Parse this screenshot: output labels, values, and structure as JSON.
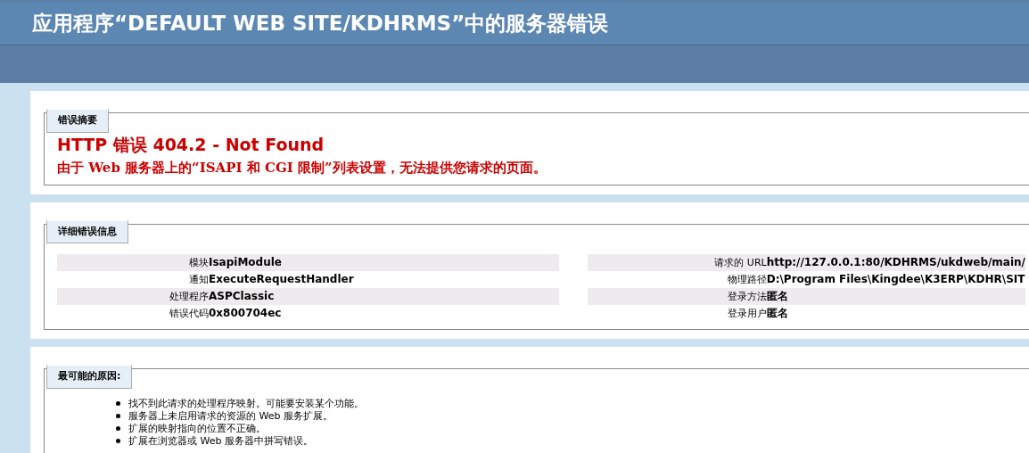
{
  "header": {
    "title": "应用程序“DEFAULT WEB SITE/KDHRMS”中的服务器错误"
  },
  "sections": [
    {
      "kind": "summary",
      "legend": "错误摘要",
      "heading": "HTTP 错误 404.2 - Not Found",
      "message": "由于 Web 服务器上的“ISAPI 和 CGI 限制”列表设置，无法提供您请求的页面。"
    },
    {
      "kind": "details",
      "legend": "详细错误信息",
      "left": [
        {
          "label": "模块",
          "value": "IsapiModule"
        },
        {
          "label": "通知",
          "value": "ExecuteRequestHandler"
        },
        {
          "label": "处理程序",
          "value": "ASPClassic"
        },
        {
          "label": "错误代码",
          "value": "0x800704ec"
        }
      ],
      "right": [
        {
          "label": "请求的 URL",
          "value": "http://127.0.0.1:80/KDHRMS/ukdweb/main/"
        },
        {
          "label": "物理路径",
          "value": "D:\\Program Files\\Kingdee\\K3ERP\\KDHR\\SIT"
        },
        {
          "label": "登录方法",
          "value": "匿名"
        },
        {
          "label": "登录用户",
          "value": "匿名"
        }
      ]
    },
    {
      "kind": "causes",
      "legend": "最可能的原因:",
      "items": [
        "找不到此请求的处理程序映射。可能要安装某个功能。",
        "服务器上未启用请求的资源的 Web 服务扩展。",
        "扩展的映射指向的位置不正确。",
        "扩展在浏览器或 Web 服务器中拼写错误。"
      ]
    }
  ]
}
